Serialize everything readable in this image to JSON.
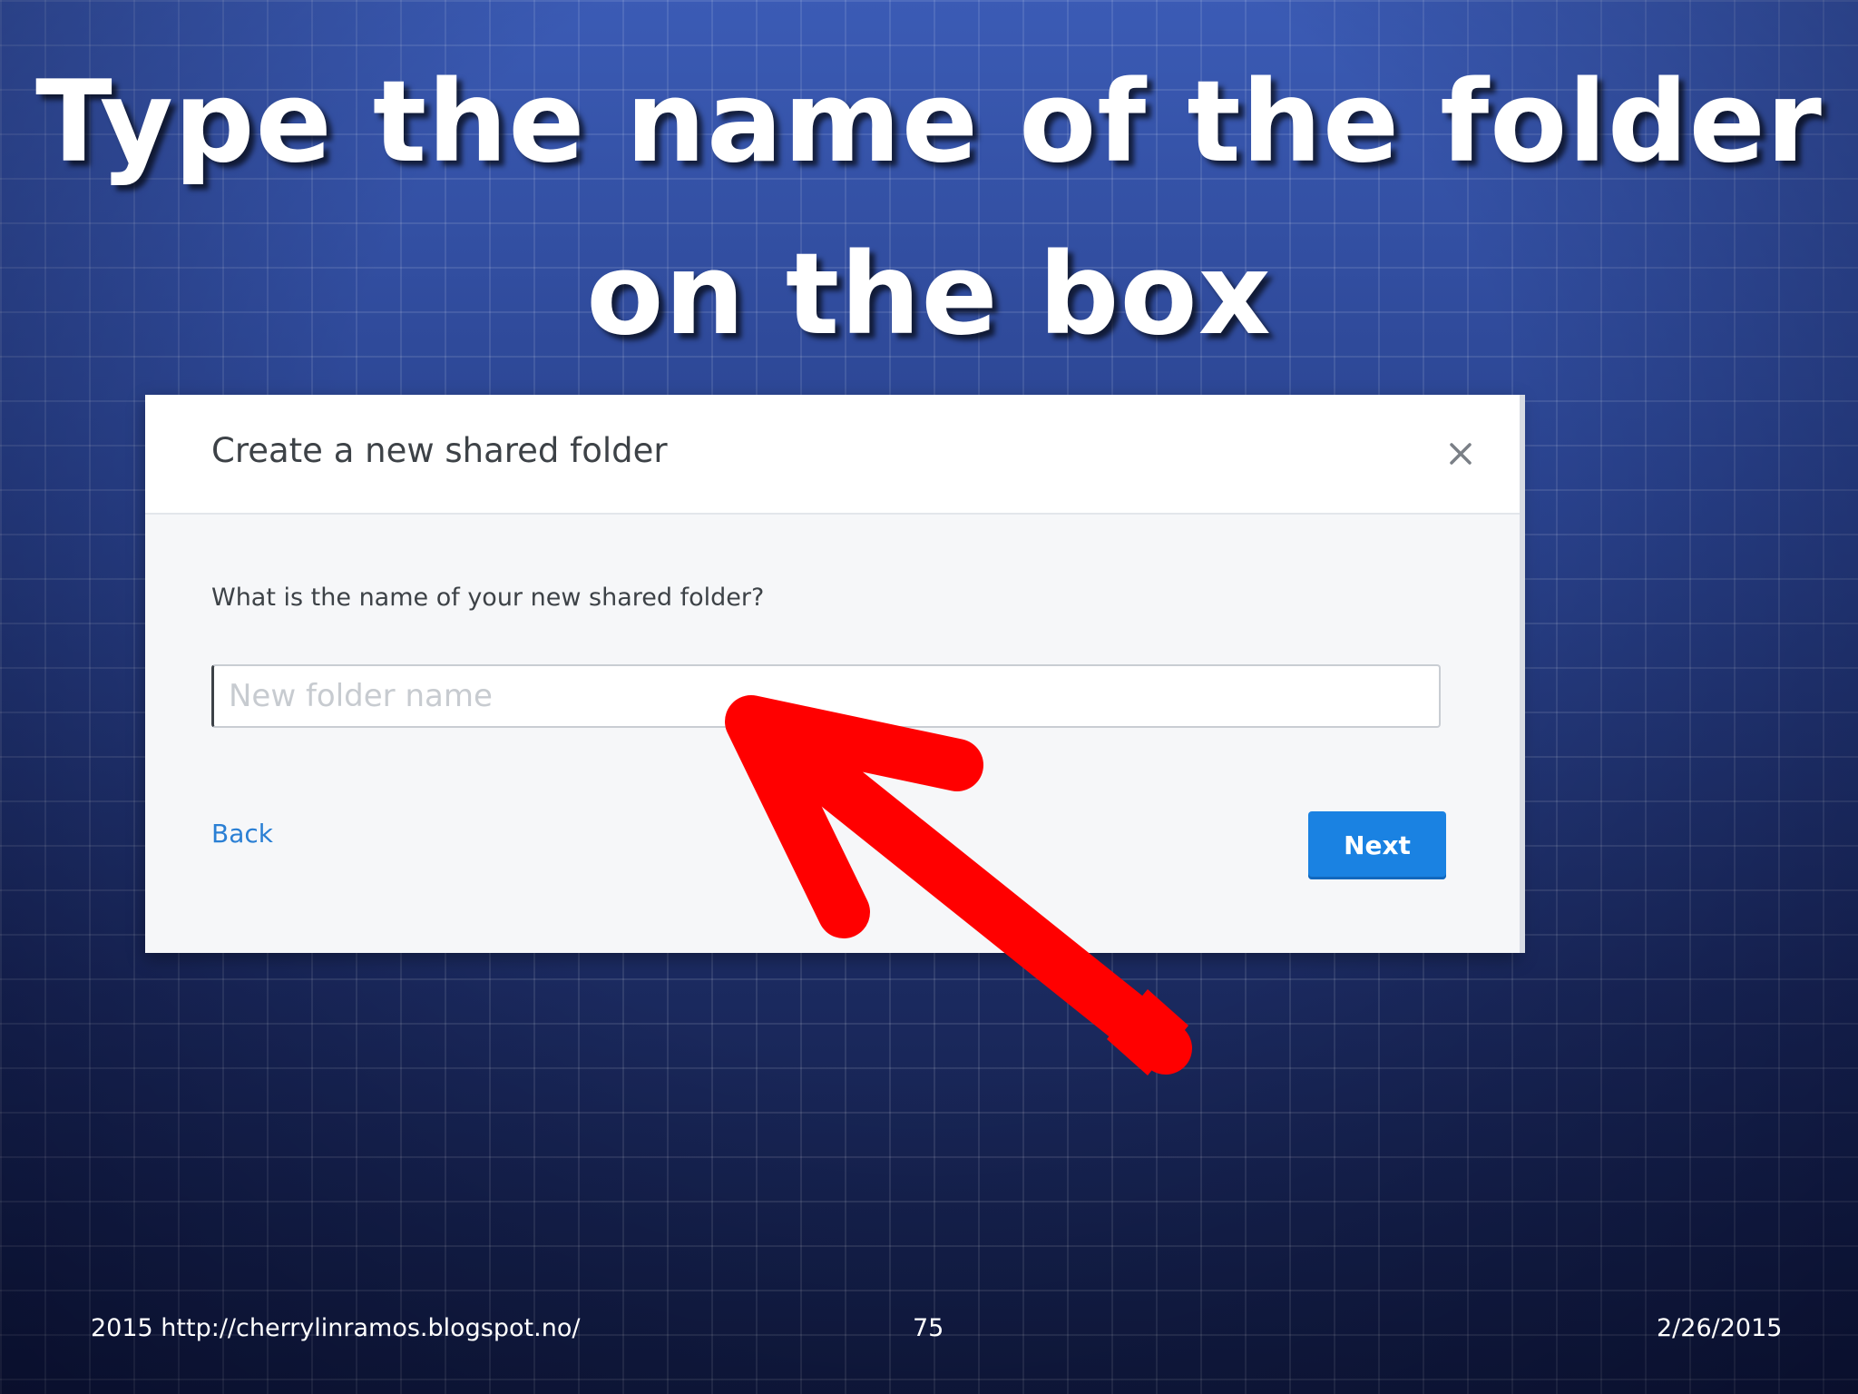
{
  "slide": {
    "title_line1": "Type the name of the folder",
    "title_line2": "on the box"
  },
  "dialog": {
    "title": "Create a new shared folder",
    "close_icon": "close-icon",
    "prompt": "What is the name of your new shared folder?",
    "input": {
      "placeholder": "New folder name",
      "value": ""
    },
    "back_label": "Back",
    "next_label": "Next"
  },
  "annotation": {
    "arrow_color": "#ff0000",
    "arrow_icon": "red-arrow-icon"
  },
  "footer": {
    "left": "2015 http://cherrylinramos.blogspot.no/",
    "center": "75",
    "right": "2/26/2015"
  },
  "colors": {
    "accent": "#1a82e2",
    "link": "#2a7fd4",
    "background": "#2a438f"
  }
}
